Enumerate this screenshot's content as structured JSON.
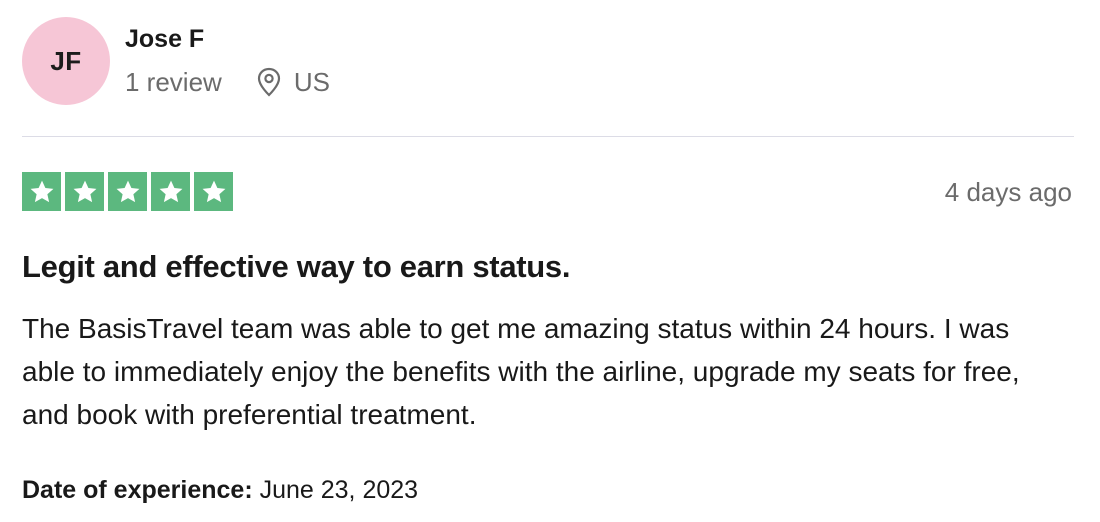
{
  "reviewer": {
    "initials": "JF",
    "avatar_color": "#f6c6d6",
    "name": "Jose F",
    "review_count": "1 review",
    "location_icon": "location-pin-icon",
    "country": "US"
  },
  "rating": {
    "stars": 5,
    "max_stars": 5,
    "star_color": "#5cb87f",
    "star_icon": "star-icon"
  },
  "review": {
    "time_ago": "4 days ago",
    "title": "Legit and effective way to earn status.",
    "body": "The BasisTravel team was able to get me amazing status within 24 hours. I was able to immediately enjoy the benefits with the airline, upgrade my seats for free, and book with preferential treatment.",
    "date_label": "Date of experience:",
    "date_value": "June 23, 2023"
  }
}
